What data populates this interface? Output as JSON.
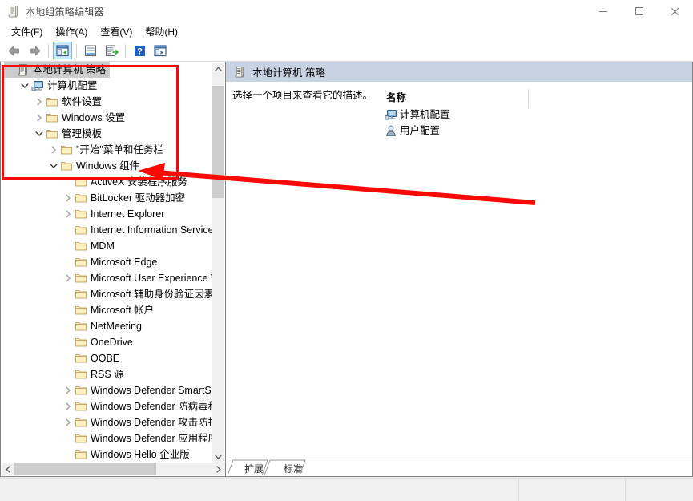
{
  "window": {
    "title": "本地组策略编辑器",
    "icon": "policy-document-icon",
    "minimize_label": "最小化",
    "maximize_label": "最大化",
    "close_label": "关闭"
  },
  "menubar": {
    "items": [
      {
        "label": "文件(F)",
        "name": "menu-file"
      },
      {
        "label": "操作(A)",
        "name": "menu-action"
      },
      {
        "label": "查看(V)",
        "name": "menu-view"
      },
      {
        "label": "帮助(H)",
        "name": "menu-help"
      }
    ]
  },
  "toolbar": {
    "buttons": [
      {
        "name": "back-button",
        "icon": "arrow-left-icon",
        "selected": false
      },
      {
        "name": "forward-button",
        "icon": "arrow-right-icon",
        "selected": false
      },
      {
        "name": "show-hide-tree-button",
        "icon": "tree-pane-icon",
        "selected": true
      },
      {
        "name": "properties-button",
        "icon": "properties-icon",
        "selected": false
      },
      {
        "name": "export-list-button",
        "icon": "export-list-icon",
        "selected": false
      },
      {
        "name": "help-button",
        "icon": "question-mark-icon",
        "selected": false
      },
      {
        "name": "show-console-tree-button",
        "icon": "console-tree-icon",
        "selected": false
      }
    ]
  },
  "tree": {
    "nodes": [
      {
        "label": "本地计算机 策略",
        "indent": 0,
        "icon": "policy-document-icon",
        "twisty": "none",
        "selected": true
      },
      {
        "label": "计算机配置",
        "indent": 1,
        "icon": "computer-icon",
        "twisty": "expanded",
        "selected": false
      },
      {
        "label": "软件设置",
        "indent": 2,
        "icon": "folder-icon",
        "twisty": "collapsed",
        "selected": false
      },
      {
        "label": "Windows 设置",
        "indent": 2,
        "icon": "folder-icon",
        "twisty": "collapsed",
        "selected": false
      },
      {
        "label": "管理模板",
        "indent": 2,
        "icon": "folder-icon",
        "twisty": "expanded",
        "selected": false
      },
      {
        "label": "\"开始\"菜单和任务栏",
        "indent": 3,
        "icon": "folder-icon",
        "twisty": "collapsed",
        "selected": false
      },
      {
        "label": "Windows 组件",
        "indent": 3,
        "icon": "folder-icon",
        "twisty": "expanded",
        "selected": false
      },
      {
        "label": "ActiveX 安装程序服务",
        "indent": 4,
        "icon": "folder-icon",
        "twisty": "none",
        "selected": false
      },
      {
        "label": "BitLocker 驱动器加密",
        "indent": 4,
        "icon": "folder-icon",
        "twisty": "collapsed",
        "selected": false
      },
      {
        "label": "Internet Explorer",
        "indent": 4,
        "icon": "folder-icon",
        "twisty": "collapsed",
        "selected": false
      },
      {
        "label": "Internet Information Service",
        "indent": 4,
        "icon": "folder-icon",
        "twisty": "none",
        "selected": false
      },
      {
        "label": "MDM",
        "indent": 4,
        "icon": "folder-icon",
        "twisty": "none",
        "selected": false
      },
      {
        "label": "Microsoft Edge",
        "indent": 4,
        "icon": "folder-icon",
        "twisty": "none",
        "selected": false
      },
      {
        "label": "Microsoft User Experience V",
        "indent": 4,
        "icon": "folder-icon",
        "twisty": "collapsed",
        "selected": false
      },
      {
        "label": "Microsoft 辅助身份验证因素",
        "indent": 4,
        "icon": "folder-icon",
        "twisty": "none",
        "selected": false
      },
      {
        "label": "Microsoft 帐户",
        "indent": 4,
        "icon": "folder-icon",
        "twisty": "none",
        "selected": false
      },
      {
        "label": "NetMeeting",
        "indent": 4,
        "icon": "folder-icon",
        "twisty": "none",
        "selected": false
      },
      {
        "label": "OneDrive",
        "indent": 4,
        "icon": "folder-icon",
        "twisty": "none",
        "selected": false
      },
      {
        "label": "OOBE",
        "indent": 4,
        "icon": "folder-icon",
        "twisty": "none",
        "selected": false
      },
      {
        "label": "RSS 源",
        "indent": 4,
        "icon": "folder-icon",
        "twisty": "none",
        "selected": false
      },
      {
        "label": "Windows Defender SmartSc",
        "indent": 4,
        "icon": "folder-icon",
        "twisty": "collapsed",
        "selected": false
      },
      {
        "label": "Windows Defender 防病毒程",
        "indent": 4,
        "icon": "folder-icon",
        "twisty": "collapsed",
        "selected": false
      },
      {
        "label": "Windows Defender 攻击防护",
        "indent": 4,
        "icon": "folder-icon",
        "twisty": "collapsed",
        "selected": false
      },
      {
        "label": "Windows Defender 应用程序",
        "indent": 4,
        "icon": "folder-icon",
        "twisty": "none",
        "selected": false
      },
      {
        "label": "Windows Hello 企业版",
        "indent": 4,
        "icon": "folder-icon",
        "twisty": "none",
        "selected": false
      }
    ],
    "scroll_up_glyph": "⌃",
    "scroll_down_glyph": "⌄",
    "scroll_left_glyph": "‹",
    "scroll_right_glyph": "›"
  },
  "right_pane": {
    "header_title": "本地计算机 策略",
    "header_icon": "policy-document-icon",
    "description": "选择一个项目来查看它的描述。",
    "column_header": "名称",
    "rows": [
      {
        "label": "计算机配置",
        "icon": "computer-icon"
      },
      {
        "label": "用户配置",
        "icon": "user-icon"
      }
    ],
    "tabs": [
      {
        "label": "扩展",
        "name": "tab-extended",
        "active": true
      },
      {
        "label": "标准",
        "name": "tab-standard",
        "active": false
      }
    ]
  },
  "annotation": {
    "box_color": "#fb0a05",
    "arrow_color": "#fb0a05",
    "arrow_target": "Windows 组件"
  },
  "colors": {
    "header_band": "#c7d3e3",
    "selection": "#cccccc",
    "toolbar_selected": "#cde8f6",
    "folder_fill": "#fdf3c9",
    "folder_border": "#c9a96a",
    "annotation_red": "#fb0a05"
  }
}
